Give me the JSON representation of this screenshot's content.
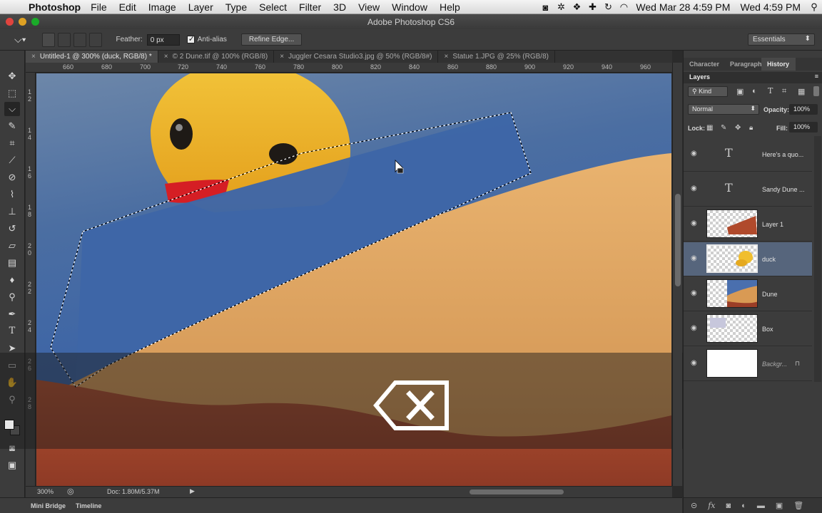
{
  "menubar": {
    "apple": "",
    "app_name": "Photoshop",
    "menus": [
      "File",
      "Edit",
      "Image",
      "Layer",
      "Type",
      "Select",
      "Filter",
      "3D",
      "View",
      "Window",
      "Help"
    ],
    "status_icons": [
      "camera-icon",
      "brightness-icon",
      "dropbox-icon",
      "plus-icon",
      "sync-icon",
      "wifi-icon"
    ],
    "datetime": "Wed Mar 28  4:59 PM",
    "clock": "Wed 4:59 PM"
  },
  "window": {
    "title": "Adobe Photoshop CS6"
  },
  "options": {
    "feather_label": "Feather:",
    "feather_value": "0 px",
    "antialias_label": "Anti-alias",
    "antialias_checked": true,
    "refine_edge_label": "Refine Edge...",
    "workspace": "Essentials"
  },
  "tabs": [
    {
      "label": "Untitled-1 @ 300% (duck, RGB/8) *",
      "active": true
    },
    {
      "label": "© 2 Dune.tif @ 100% (RGB/8)",
      "active": false
    },
    {
      "label": "Juggler Cesara Studio3.jpg @ 50% (RGB/8#)",
      "active": false
    },
    {
      "label": "Statue 1.JPG @ 25% (RGB/8)",
      "active": false
    }
  ],
  "ruler": {
    "h_labels": [
      "660",
      "680",
      "700",
      "720",
      "740",
      "760",
      "780",
      "800",
      "820",
      "840",
      "860",
      "880",
      "900",
      "920",
      "940",
      "960"
    ],
    "v_labels": [
      "1",
      "2",
      "1",
      "4",
      "1",
      "6",
      "1",
      "8",
      "2",
      "0",
      "2",
      "2",
      "2",
      "4",
      "2",
      "6",
      "2",
      "8"
    ]
  },
  "statusbar": {
    "zoom": "300%",
    "doc": "Doc: 1.80M/5.37M"
  },
  "bottom_panel": {
    "tabs": [
      "Mini Bridge",
      "Timeline"
    ]
  },
  "panels": {
    "tabs": [
      "Character",
      "Paragraph",
      "History"
    ],
    "active_tab": "History",
    "layers_title": "Layers",
    "kind_label": "Kind",
    "blend_mode": "Normal",
    "opacity_label": "Opacity:",
    "opacity_value": "100%",
    "lock_label": "Lock:",
    "fill_label": "Fill:",
    "fill_value": "100%"
  },
  "layers": [
    {
      "name": "Here's a quo...",
      "type": "text",
      "selected": false
    },
    {
      "name": "Sandy Dune ...",
      "type": "text",
      "selected": false
    },
    {
      "name": "Layer 1",
      "type": "image",
      "selected": false
    },
    {
      "name": "duck",
      "type": "image",
      "selected": true
    },
    {
      "name": "Dune",
      "type": "image",
      "selected": false
    },
    {
      "name": "Box",
      "type": "image",
      "selected": false
    },
    {
      "name": "Backgr...",
      "type": "background",
      "selected": false
    }
  ],
  "overlay": {
    "icon": "delete-key-icon"
  }
}
